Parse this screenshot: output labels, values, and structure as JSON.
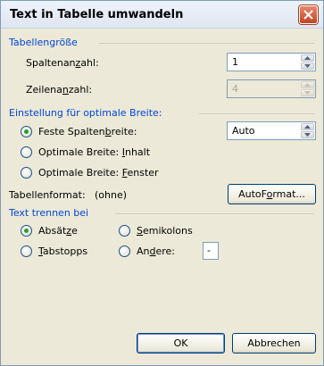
{
  "window": {
    "title": "Text in Tabelle umwandeln"
  },
  "groups": {
    "tabellengroesse": "Tabellengröße",
    "breite": "Einstellung für optimale Breite:",
    "trennen": "Text trennen bei"
  },
  "spalten": {
    "label_pre": "Spaltenan",
    "label_u": "z",
    "label_post": "ahl:",
    "value": "1"
  },
  "zeilen": {
    "label_pre": "Zeilena",
    "label_u": "n",
    "label_post": "zahl:",
    "value": "4"
  },
  "width_options": {
    "fixed": {
      "pre": "Feste Spalten",
      "u": "b",
      "post": "reite:"
    },
    "content": {
      "pre": "Optimale Breite: ",
      "u": "I",
      "post": "nhalt"
    },
    "window": {
      "pre": "Optimale Breite: ",
      "u": "F",
      "post": "enster"
    },
    "fixed_value": "Auto"
  },
  "table_format": {
    "label": "Tabellenformat:",
    "value": "(ohne)",
    "button_pre": "AutoF",
    "button_u": "o",
    "button_post": "rmat..."
  },
  "separators": {
    "absaetze": {
      "pre": "Absät",
      "u": "z",
      "post": "e"
    },
    "semikolons": {
      "pre": "",
      "u": "S",
      "post": "emikolons"
    },
    "tabstopps": {
      "pre": "",
      "u": "T",
      "post": "abstopps"
    },
    "andere": {
      "pre": "An",
      "u": "d",
      "post": "ere:"
    },
    "andere_value": "-"
  },
  "buttons": {
    "ok": "OK",
    "cancel": "Abbrechen"
  }
}
